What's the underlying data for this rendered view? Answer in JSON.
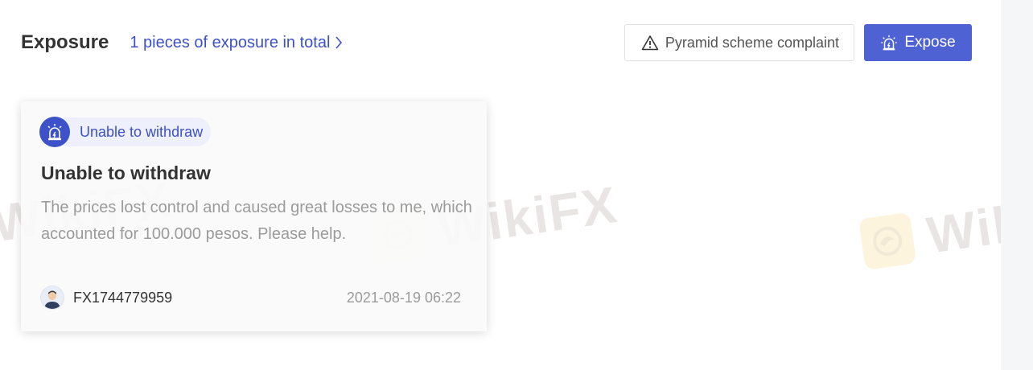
{
  "header": {
    "title": "Exposure",
    "total_link": "1 pieces of exposure in total",
    "complaint_button": "Pyramid scheme complaint",
    "expose_button": "Expose"
  },
  "card": {
    "tag_label": "Unable to withdraw",
    "title": "Unable to withdraw",
    "description": "The prices lost control and caused great losses to me, which accounted for 100.000 pesos. Please help.",
    "username": "FX1744779959",
    "date": "2021-08-19 06:22"
  },
  "watermark": {
    "text": "WikiFX"
  },
  "colors": {
    "accent": "#3d51c8",
    "expose_button_bg": "#4f62d4",
    "tag_bg": "#eef0fb"
  },
  "icons": {
    "total_link": "chevron-right-icon",
    "complaint": "warning-triangle-icon",
    "expose": "alarm-siren-icon",
    "tag": "alarm-siren-icon",
    "user": "user-avatar-icon"
  }
}
